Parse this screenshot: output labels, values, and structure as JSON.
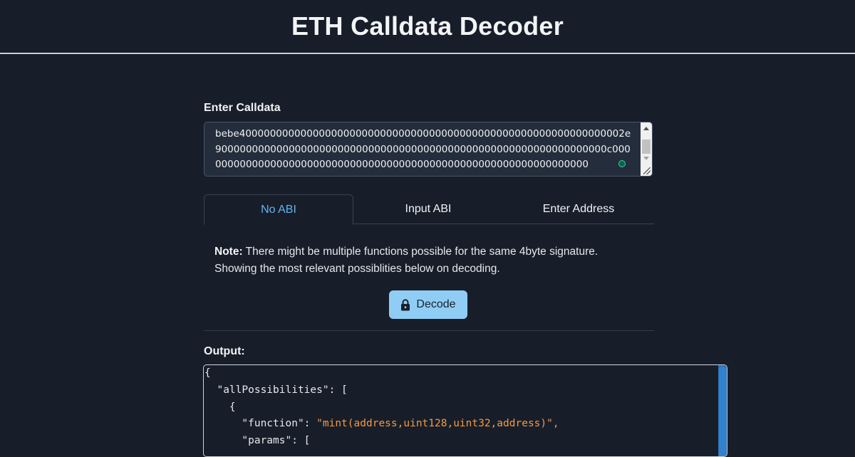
{
  "header": {
    "title": "ETH Calldata Decoder"
  },
  "calldata": {
    "label": "Enter Calldata",
    "value": "bebe400000000000000000000000000000000000000000000000000000000000002e9000000000000000000000000000000000000000000000000000000000000000c0000000000000000000000000000000000000000000000000000000000000000"
  },
  "tabs": [
    {
      "label": "No ABI",
      "active": true
    },
    {
      "label": "Input ABI",
      "active": false
    },
    {
      "label": "Enter Address",
      "active": false
    }
  ],
  "note": {
    "prefix": "Note:",
    "text": "There might be multiple functions possible for the same 4byte signature. Showing the most relevant possiblities below on decoding."
  },
  "decode_button": {
    "label": "Decode",
    "icon": "lock-icon"
  },
  "output": {
    "label": "Output:",
    "lines": [
      "{",
      "  \"allPossibilities\": [",
      "    {",
      "      \"function\": ",
      "      \"params\": ["
    ],
    "function_signature": "\"mint(address,uint128,uint32,address)\","
  },
  "colors": {
    "background": "#171e2a",
    "accent": "#63b3ed",
    "button": "#90cdf4",
    "string": "#f6993f"
  }
}
